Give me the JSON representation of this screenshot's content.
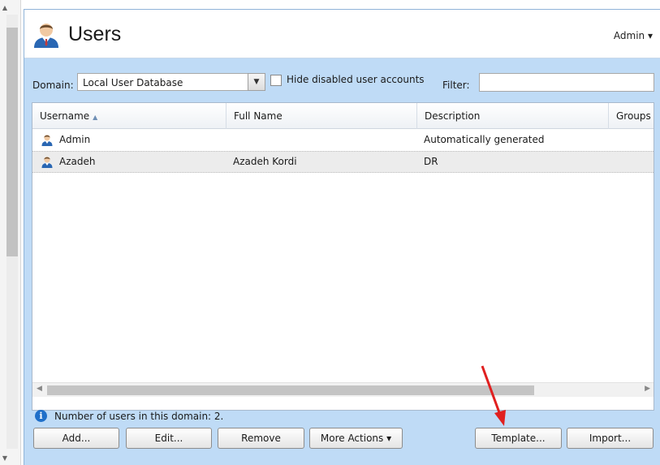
{
  "header": {
    "title": "Users",
    "user_menu": "Admin ▾"
  },
  "toolbar": {
    "domain_label": "Domain:",
    "domain_value": "Local User Database",
    "hide_disabled_label": "Hide disabled user accounts",
    "hide_disabled_checked": false,
    "filter_label": "Filter:",
    "filter_value": ""
  },
  "grid": {
    "columns": [
      {
        "label": "Username",
        "sort": "ascending"
      },
      {
        "label": "Full Name"
      },
      {
        "label": "Description"
      },
      {
        "label": "Groups"
      }
    ],
    "rows": [
      {
        "username": "Admin",
        "full_name": "",
        "description": "Automatically generated",
        "groups": ""
      },
      {
        "username": "Azadeh",
        "full_name": "Azadeh Kordi",
        "description": "DR",
        "groups": ""
      }
    ]
  },
  "status": {
    "text": "Number of users in this domain: 2."
  },
  "buttons": {
    "add": "Add...",
    "edit": "Edit...",
    "remove": "Remove",
    "more_actions": "More Actions ▾",
    "template": "Template...",
    "import": "Import..."
  },
  "icons": {
    "users": "users-icon",
    "user": "user-icon",
    "info": "info-icon",
    "annotation": "red-arrow-annotation"
  },
  "colors": {
    "panel_background": "#bfdbf6",
    "info_icon": "#1f6fc9",
    "annotation_arrow": "#e02020"
  }
}
